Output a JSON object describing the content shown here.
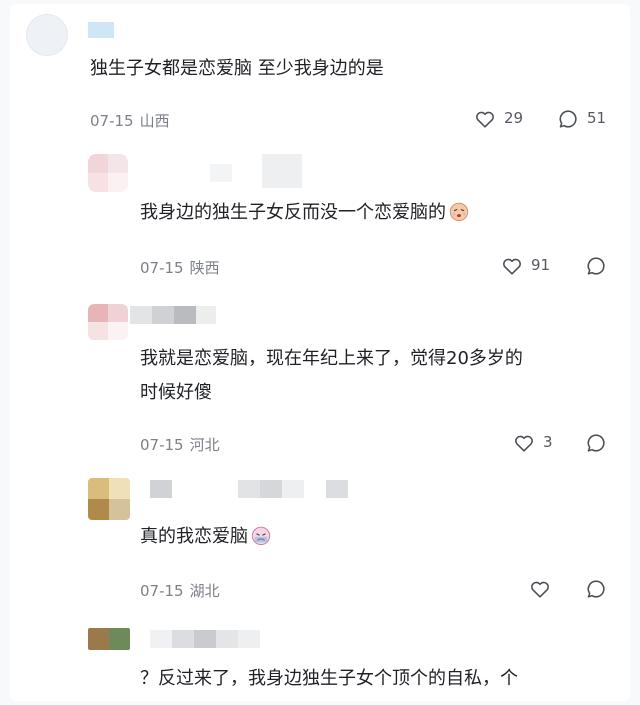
{
  "comments": [
    {
      "text": "独生子女都是恋爱脑 至少我身边的是",
      "date": "07-15",
      "location": "山西",
      "likes": "29",
      "replies": "51"
    },
    {
      "text": "我身边的独生子女反而没一个恋爱脑的",
      "emoji_icon": "crying-face-emoji",
      "date": "07-15",
      "location": "陕西",
      "likes": "91"
    },
    {
      "text_line1": "我就是恋爱脑，现在年纪上来了，觉得20多岁的",
      "text_line2": "时候好傻",
      "date": "07-15",
      "location": "河北",
      "likes": "3"
    },
    {
      "text": "真的我恋爱脑",
      "emoji_icon": "sad-face-emoji",
      "date": "07-15",
      "location": "湖北"
    },
    {
      "text": "？反过来了，我身边独生子女个顶个的自私，个"
    }
  ],
  "colors": {
    "text": "#1f2126",
    "meta": "#7c8089",
    "icon_stroke": "#4a4e56"
  }
}
